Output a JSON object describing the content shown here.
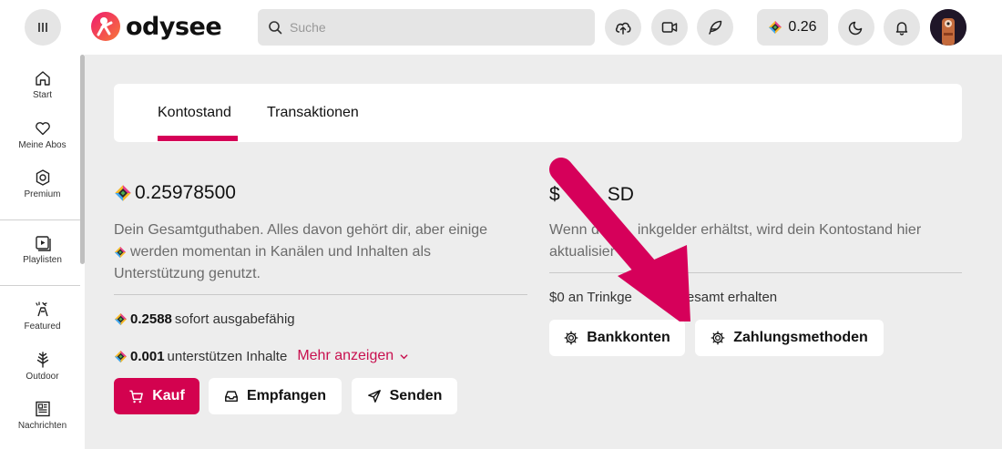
{
  "header": {
    "logo_text": "odysee",
    "search": {
      "placeholder": "Suche"
    },
    "wallet_balance": "0.26"
  },
  "sidebar": {
    "items": [
      {
        "label": "Start",
        "icon": "home-icon"
      },
      {
        "label": "Meine Abos",
        "icon": "heart-icon"
      },
      {
        "label": "Premium",
        "icon": "premium-icon"
      },
      {
        "label": "Playlisten",
        "icon": "playlist-icon"
      },
      {
        "label": "Featured",
        "icon": "featured-icon"
      },
      {
        "label": "Outdoor",
        "icon": "tree-icon"
      },
      {
        "label": "Nachrichten",
        "icon": "news-icon"
      }
    ]
  },
  "tabs": [
    {
      "label": "Kontostand",
      "active": true
    },
    {
      "label": "Transaktionen",
      "active": false
    }
  ],
  "wallet": {
    "total_balance": "0.25978500",
    "description_line1": "Dein Gesamtguthaben. Alles davon gehört dir, aber einige",
    "description_line2": "werden momentan in Kanälen und Inhalten als",
    "description_line3": "Unterstützung genutzt.",
    "spendable_amount": "0.2588",
    "spendable_label": "sofort ausgabefähig",
    "supports_amount": "0.001",
    "supports_label": "unterstützen Inhalte",
    "show_more_label": "Mehr anzeigen",
    "buy_label": "Kauf",
    "receive_label": "Empfangen",
    "send_label": "Senden"
  },
  "fiat": {
    "balance_prefix": "$",
    "balance_suffix": "SD",
    "description_start": "Wenn d",
    "description_end": "inkgelder erhältst, wird dein Kontostand hier",
    "description_line2": "aktualisier",
    "tips_total_start": "$0 an Trinkge",
    "tips_total_end": "esamt erhalten",
    "bank_accounts_label": "Bankkonten",
    "payment_methods_label": "Zahlungsmethoden"
  },
  "colors": {
    "accent": "#d3024f",
    "arrow": "#d6005a",
    "background": "#ededed"
  }
}
